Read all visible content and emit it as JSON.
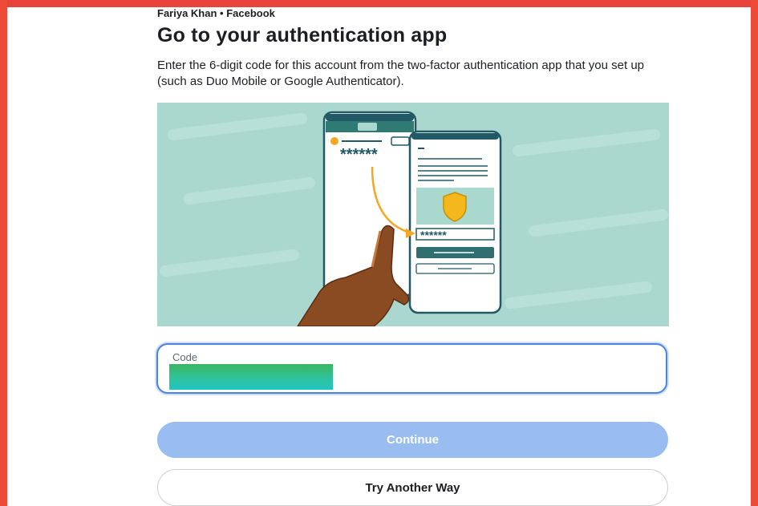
{
  "header": {
    "account": "Fariya Khan • Facebook",
    "title": "Go to your authentication app",
    "description": "Enter the 6-digit code for this account from the two-factor authentication app that you set up (such as Duo Mobile or Google Authenticator)."
  },
  "illustration": {
    "code_mask_left": "******",
    "code_mask_right": "******"
  },
  "form": {
    "code_label": "Code",
    "code_value": ""
  },
  "actions": {
    "continue_label": "Continue",
    "try_another_label": "Try Another Way"
  },
  "colors": {
    "frame": "#ee4a38",
    "accent_blue": "#4a83e0",
    "continue_disabled": "#99bdf0",
    "illustration_bg": "#a9d8cf",
    "dark_teal": "#215966",
    "shield_yellow": "#f5b81c"
  }
}
